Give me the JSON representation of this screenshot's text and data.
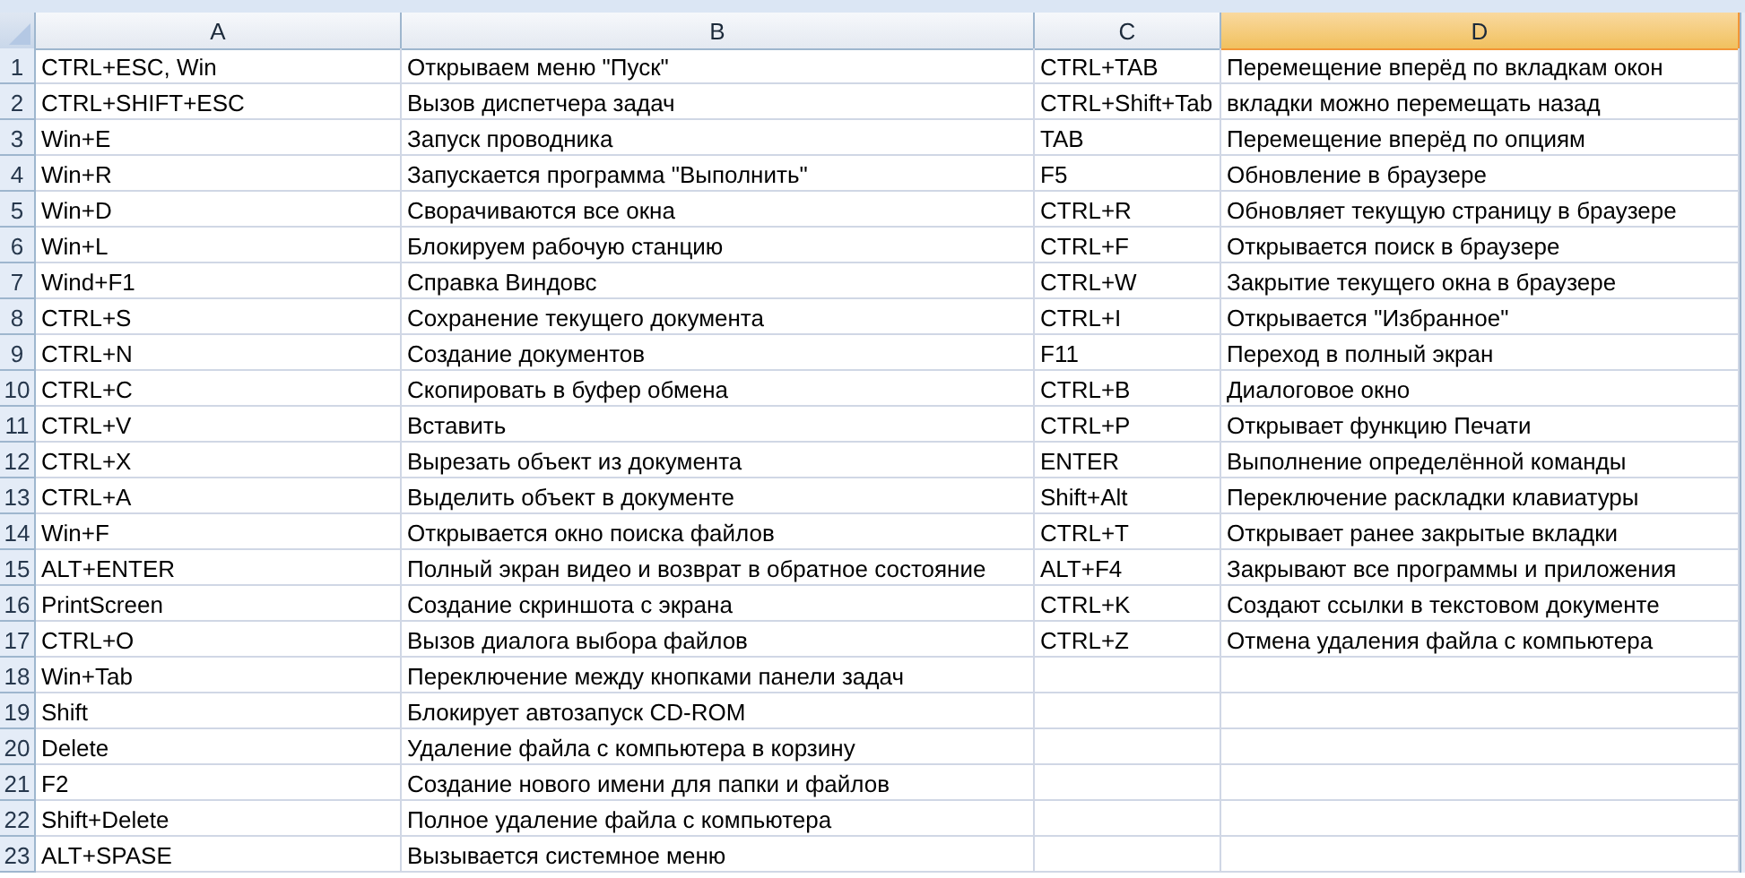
{
  "columns": [
    {
      "label": "A",
      "selected": false
    },
    {
      "label": "B",
      "selected": false
    },
    {
      "label": "C",
      "selected": false
    },
    {
      "label": "D",
      "selected": true
    }
  ],
  "rows": [
    {
      "number": "1",
      "cells": [
        "CTRL+ESC, Win",
        "Открываем меню \"Пуск\"",
        "CTRL+TAB",
        "Перемещение вперёд по вкладкам окон"
      ]
    },
    {
      "number": "2",
      "cells": [
        "CTRL+SHIFT+ESC",
        "Вызов диспетчера задач",
        "CTRL+Shift+Tab",
        "вкладки можно перемещать назад"
      ]
    },
    {
      "number": "3",
      "cells": [
        "Win+E",
        "Запуск проводника",
        "TAB",
        "Перемещение вперёд по опциям"
      ]
    },
    {
      "number": "4",
      "cells": [
        "Win+R",
        "Запускается программа \"Выполнить\"",
        "F5",
        "Обновление в браузере"
      ]
    },
    {
      "number": "5",
      "cells": [
        "Win+D",
        "Сворачиваются все окна",
        "CTRL+R",
        "Обновляет текущую страницу в браузере"
      ]
    },
    {
      "number": "6",
      "cells": [
        "Win+L",
        "Блокируем рабочую станцию",
        "CTRL+F",
        "Открывается поиск в браузере"
      ]
    },
    {
      "number": "7",
      "cells": [
        "Wind+F1",
        "Справка Виндовс",
        "CTRL+W",
        "Закрытие текущего окна в браузере"
      ]
    },
    {
      "number": "8",
      "cells": [
        "CTRL+S",
        "Сохранение текущего документа",
        "CTRL+I",
        "Открывается \"Избранное\""
      ]
    },
    {
      "number": "9",
      "cells": [
        "CTRL+N",
        "Создание документов",
        "F11",
        "Переход в полный экран"
      ]
    },
    {
      "number": "10",
      "cells": [
        "CTRL+C",
        "Скопировать в буфер обмена",
        "CTRL+B",
        "Диалоговое окно"
      ]
    },
    {
      "number": "11",
      "cells": [
        "CTRL+V",
        "Вставить",
        "CTRL+P",
        "Открывает функцию Печати"
      ]
    },
    {
      "number": "12",
      "cells": [
        "CTRL+X",
        "Вырезать объект из документа",
        "ENTER",
        "Выполнение определённой команды"
      ]
    },
    {
      "number": "13",
      "cells": [
        "CTRL+A",
        "Выделить объект в документе",
        "Shift+Alt",
        "Переключение раскладки клавиатуры"
      ]
    },
    {
      "number": "14",
      "cells": [
        "Win+F",
        "Открывается окно поиска файлов",
        "CTRL+T",
        "Открывает ранее закрытые вкладки"
      ]
    },
    {
      "number": "15",
      "cells": [
        "ALT+ENTER",
        "Полный экран видео и возврат в обратное состояние",
        "ALT+F4",
        "Закрывают все программы и приложения"
      ]
    },
    {
      "number": "16",
      "cells": [
        "PrintScreen",
        "Создание скриншота с экрана",
        "CTRL+K",
        "Создают ссылки в текстовом документе"
      ]
    },
    {
      "number": "17",
      "cells": [
        "CTRL+O",
        "Вызов диалога выбора файлов",
        "CTRL+Z",
        "Отмена удаления файла с компьютера"
      ]
    },
    {
      "number": "18",
      "cells": [
        "Win+Tab",
        "Переключение между кнопками панели задач"
      ]
    },
    {
      "number": "19",
      "cells": [
        "Shift",
        "Блокирует автозапуск CD-ROM"
      ]
    },
    {
      "number": "20",
      "cells": [
        "Delete",
        "Удаление файла с компьютера в корзину"
      ]
    },
    {
      "number": "21",
      "cells": [
        "F2",
        "Создание нового имени для папки и файлов"
      ]
    },
    {
      "number": "22",
      "cells": [
        "Shift+Delete",
        "Полное удаление файла с компьютера"
      ]
    },
    {
      "number": "23",
      "cells": [
        "ALT+SPASE",
        "Вызывается системное меню"
      ]
    }
  ]
}
